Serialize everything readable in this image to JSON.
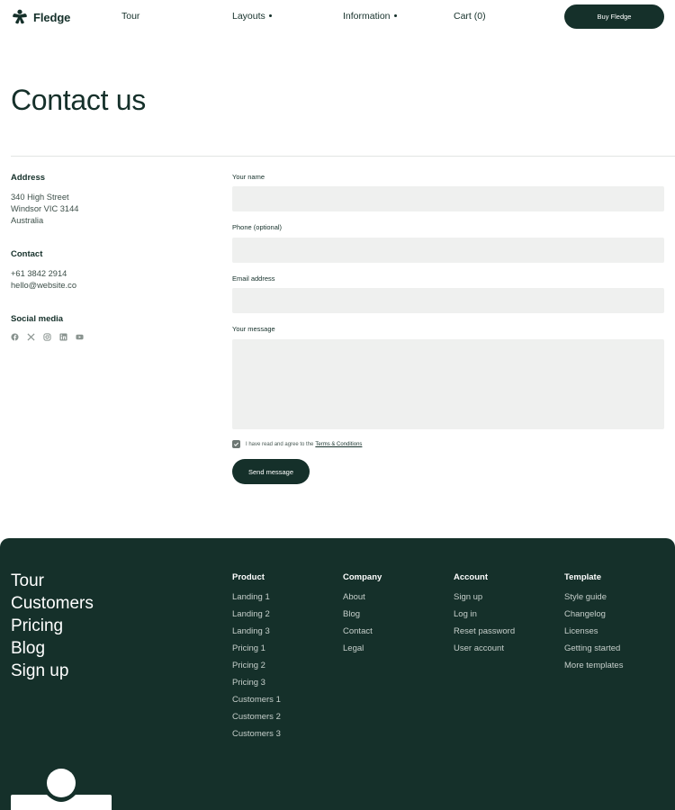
{
  "header": {
    "brand": "Fledge",
    "nav": [
      {
        "label": "Tour",
        "dropdown": false
      },
      {
        "label": "Layouts",
        "dropdown": true
      },
      {
        "label": "Information",
        "dropdown": true
      },
      {
        "label": "Cart (0)",
        "dropdown": false
      }
    ],
    "buy_label": "Buy Fledge"
  },
  "page_title": "Contact us",
  "info": {
    "address_heading": "Address",
    "address_lines": [
      "340 High Street",
      "Windsor VIC 3144",
      "Australia"
    ],
    "contact_heading": "Contact",
    "contact_lines": [
      "+61 3842 2914",
      "hello@website.co"
    ],
    "social_heading": "Social media",
    "social_icons": [
      "facebook-icon",
      "x-icon",
      "instagram-icon",
      "linkedin-icon",
      "youtube-icon"
    ]
  },
  "form": {
    "name_label": "Your name",
    "name_value": "",
    "phone_label": "Phone (optional)",
    "phone_value": "",
    "email_label": "Email address",
    "email_value": "",
    "message_label": "Your message",
    "message_value": "",
    "agree_text": "I have read and agree to the",
    "terms_link": "Terms & Conditions",
    "agree_checked": true,
    "send_label": "Send message"
  },
  "footer": {
    "big_links": [
      "Tour",
      "Customers",
      "Pricing",
      "Blog",
      "Sign up"
    ],
    "columns": [
      {
        "heading": "Product",
        "links": [
          "Landing 1",
          "Landing 2",
          "Landing 3",
          "Pricing 1",
          "Pricing 2",
          "Pricing 3",
          "Customers 1",
          "Customers 2",
          "Customers 3"
        ]
      },
      {
        "heading": "Company",
        "links": [
          "About",
          "Blog",
          "Contact",
          "Legal"
        ]
      },
      {
        "heading": "Account",
        "links": [
          "Sign up",
          "Log in",
          "Reset password",
          "User account"
        ]
      },
      {
        "heading": "Template",
        "links": [
          "Style guide",
          "Changelog",
          "Licenses",
          "Getting started",
          "More templates"
        ]
      }
    ]
  },
  "colors": {
    "brand_dark": "#15302a",
    "field_bg": "#eff0ef",
    "footer_link": "#c6cfcb"
  }
}
